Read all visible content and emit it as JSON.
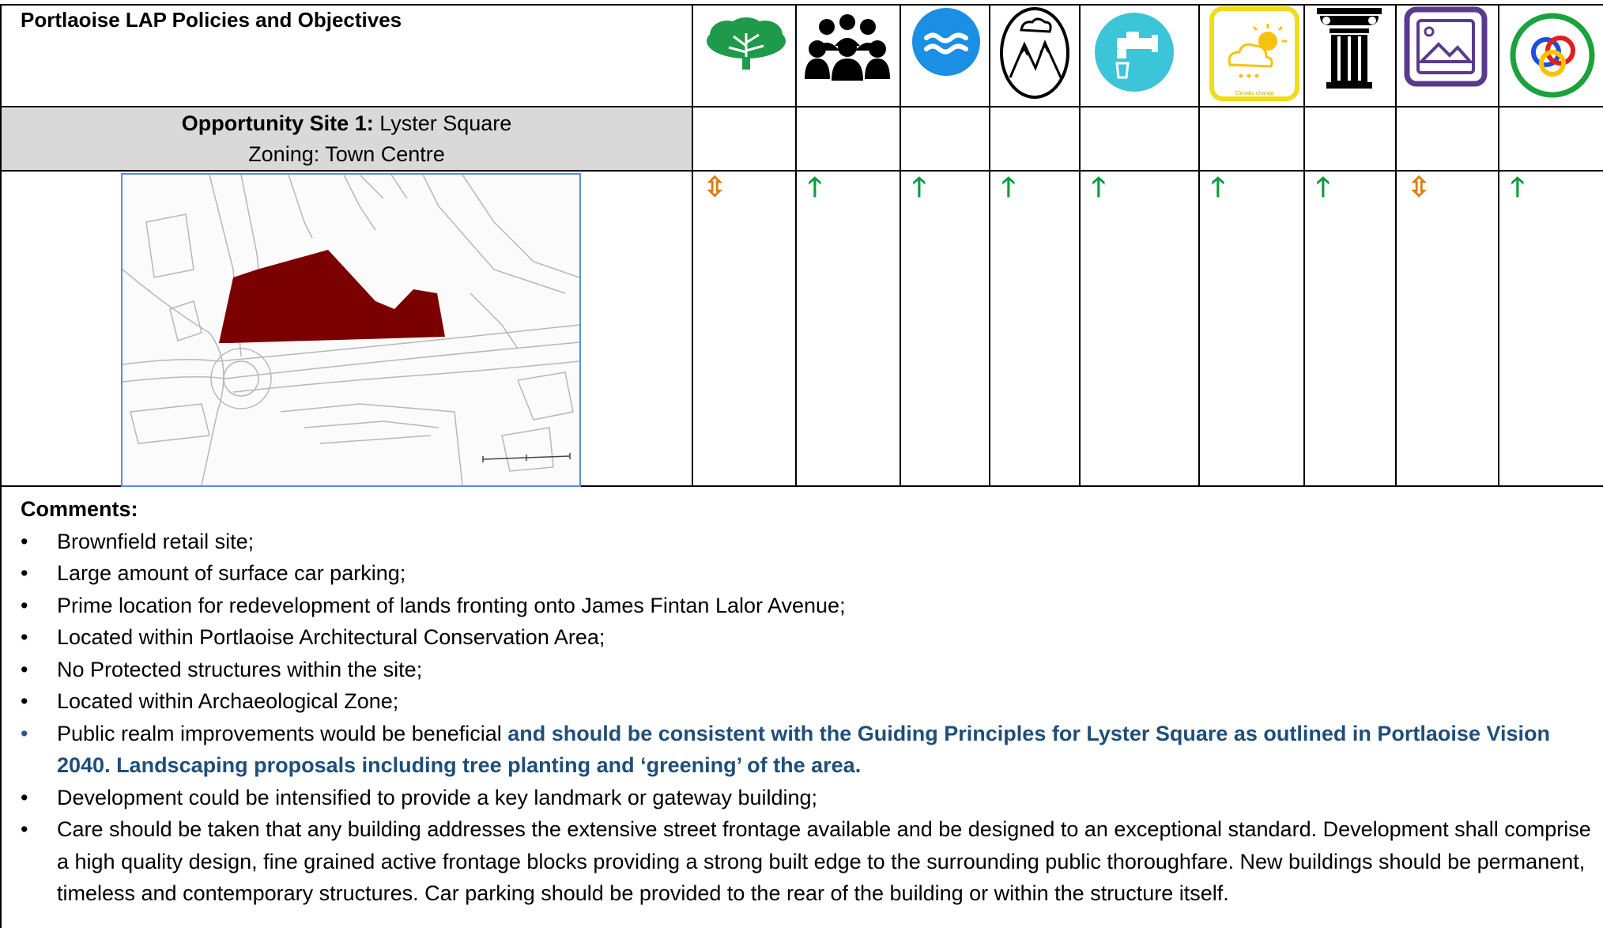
{
  "table": {
    "title": "Portlaoise LAP Policies and Objectives",
    "site_label": "Opportunity Site 1:",
    "site_name": " Lyster Square",
    "zoning": "Zoning: Town Centre"
  },
  "icons": [
    {
      "name": "biodiversity-tree-icon"
    },
    {
      "name": "population-people-icon"
    },
    {
      "name": "water-icon"
    },
    {
      "name": "soil-geology-icon"
    },
    {
      "name": "water-tap-icon"
    },
    {
      "name": "climate-weather-icon",
      "caption": "Climatic change"
    },
    {
      "name": "cultural-heritage-column-icon"
    },
    {
      "name": "landscape-picture-icon"
    },
    {
      "name": "interrelationships-rings-icon"
    }
  ],
  "effects": [
    {
      "symbol": "⇳",
      "type": "uncertain",
      "color": "#e07b00"
    },
    {
      "symbol": "🡑",
      "type": "positive",
      "color": "#0a9c3c"
    },
    {
      "symbol": "🡑",
      "type": "positive",
      "color": "#0a9c3c"
    },
    {
      "symbol": "🡑",
      "type": "positive",
      "color": "#0a9c3c"
    },
    {
      "symbol": "🡑",
      "type": "positive",
      "color": "#0a9c3c"
    },
    {
      "symbol": "🡑",
      "type": "positive",
      "color": "#0a9c3c"
    },
    {
      "symbol": "🡑",
      "type": "positive",
      "color": "#0a9c3c"
    },
    {
      "symbol": "⇳",
      "type": "uncertain",
      "color": "#e07b00"
    },
    {
      "symbol": "🡑",
      "type": "positive",
      "color": "#0a9c3c"
    }
  ],
  "comments": {
    "heading": "Comments:",
    "items": [
      {
        "text": " Brownfield retail site;"
      },
      {
        "text": "Large amount of surface car parking;"
      },
      {
        "text": "Prime location for redevelopment of lands fronting onto James Fintan Lalor Avenue;"
      },
      {
        "text": "Located within Portlaoise Architectural Conservation Area;"
      },
      {
        "text": "No Protected structures within the site;"
      },
      {
        "text": "Located within Archaeological Zone;"
      },
      {
        "text": "Public realm improvements would be beneficial ",
        "emphasis": "and should be consistent with the Guiding Principles for Lyster Square as outlined in Portlaoise Vision 2040. Landscaping proposals including tree planting and ‘greening’ of the area."
      },
      {
        "text": "Development could be intensified to provide a key landmark or gateway building;"
      },
      {
        "text": "Care should be taken that any building addresses the extensive street frontage available and be designed to an exceptional standard. Development shall comprise a high quality design, fine grained active frontage blocks providing a strong built edge to the surrounding public thoroughfare. New buildings should be permanent, timeless and contemporary structures. Car parking should be provided to the rear of the building or within the structure itself."
      }
    ]
  },
  "colors": {
    "site_fill": "#7b0000",
    "header_grey": "#d9d9d9",
    "positive": "#0a9c3c",
    "uncertain": "#e07b00",
    "emphasis_text": "#1f4e79"
  }
}
